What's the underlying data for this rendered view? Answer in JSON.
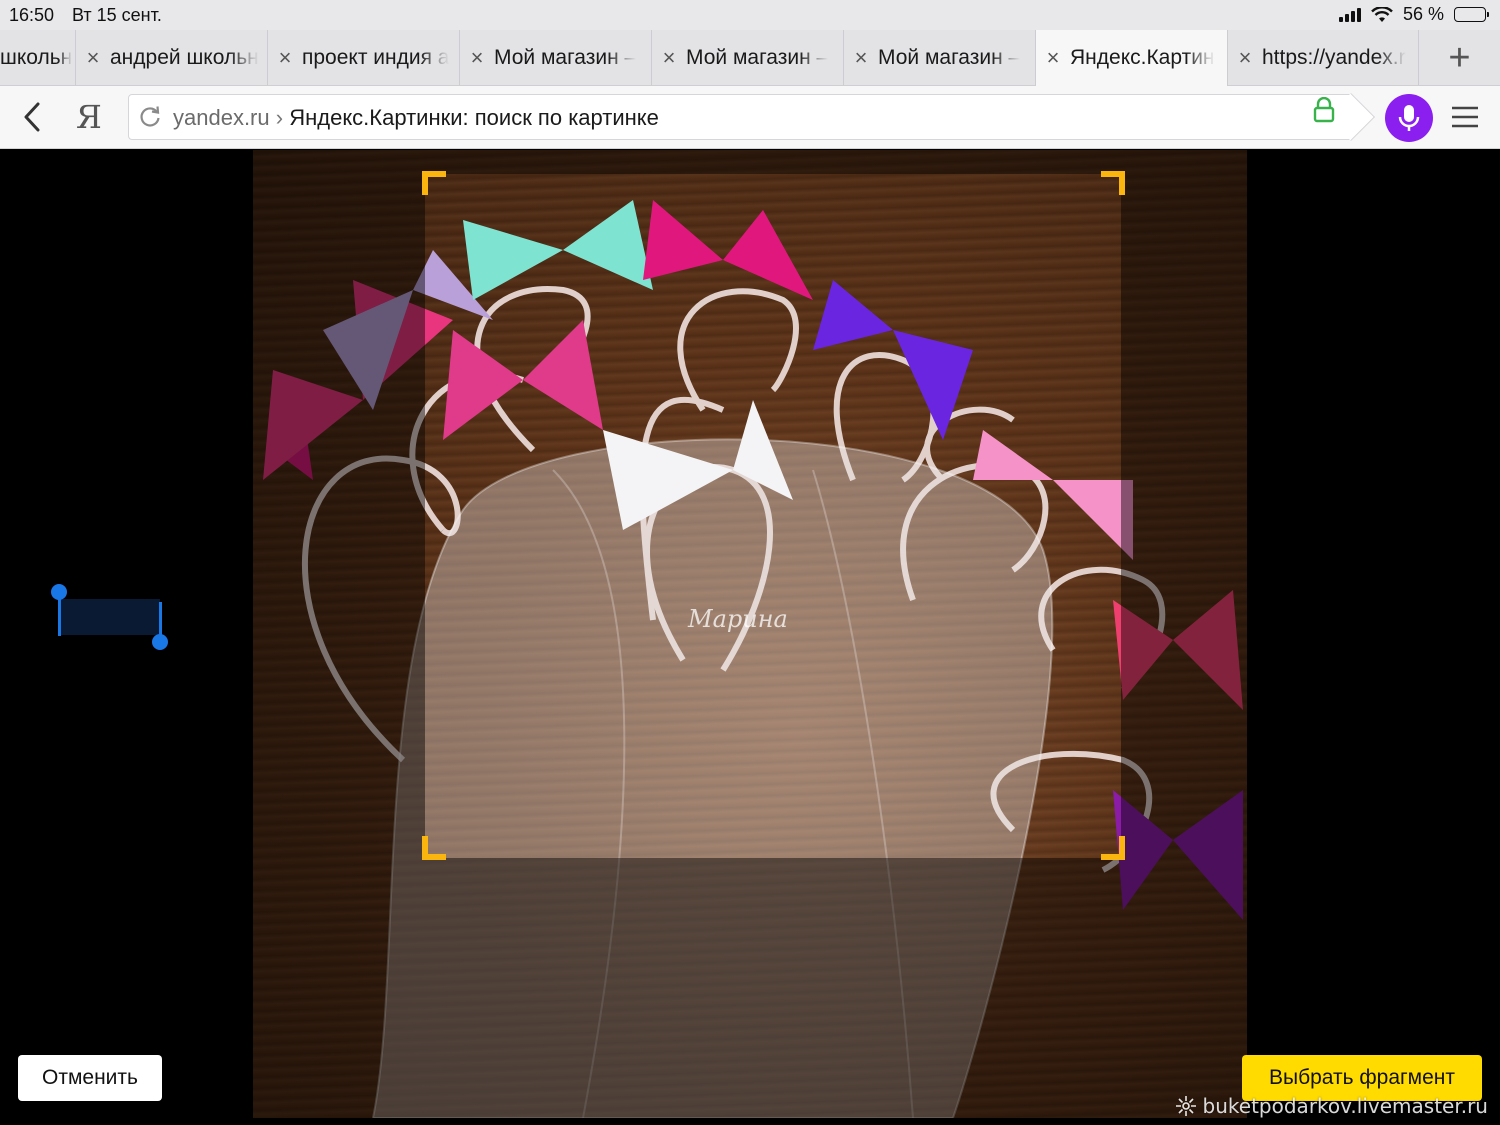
{
  "status_bar": {
    "time": "16:50",
    "date": "Вт 15 сент.",
    "battery_text": "56 %",
    "battery_level": 0.56
  },
  "tabs": [
    {
      "label": "школьн",
      "active": false
    },
    {
      "label": "андрей школьн",
      "active": false
    },
    {
      "label": "проект индия а",
      "active": false
    },
    {
      "label": "Мой магазин –",
      "active": false
    },
    {
      "label": "Мой магазин –",
      "active": false
    },
    {
      "label": "Мой магазин –",
      "active": false
    },
    {
      "label": "Яндекс.Картин",
      "active": true
    },
    {
      "label": "https://yandex.r",
      "active": false
    }
  ],
  "toolbar": {
    "logo": "Я",
    "address_host": "yandex.ru",
    "address_separator": "›",
    "address_title": "Яндекс.Картинки: поиск по картинке"
  },
  "photo": {
    "name_watermark": "Марина"
  },
  "actions": {
    "cancel": "Отменить",
    "select_fragment": "Выбрать фрагмент"
  },
  "watermark": "buketpodarkov.livemaster.ru",
  "colors": {
    "accent_crop": "#fbb50f",
    "select_button": "#ffdb00",
    "voice_button": "#8a1ff0",
    "selection_handle": "#1a78e6"
  },
  "icons": [
    "back-icon",
    "reload-icon",
    "lock-icon",
    "microphone-icon",
    "menu-icon",
    "close-icon",
    "plus-icon",
    "signal-icon",
    "wifi-icon",
    "battery-icon",
    "flower-icon"
  ]
}
